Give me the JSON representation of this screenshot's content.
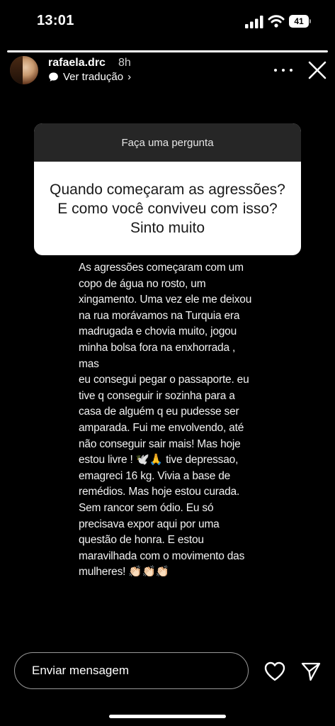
{
  "status_bar": {
    "time": "13:01",
    "battery_level": "41"
  },
  "story": {
    "progress": 1.0,
    "username": "rafaela.drc",
    "posted_ago": "8h",
    "translate_label": "Ver tradução",
    "translate_chevron": "›"
  },
  "question_sticker": {
    "header": "Faça uma pergunta",
    "question": "Quando começaram as agressões? E como você conviveu com isso? Sinto muito"
  },
  "answer": {
    "text": "As agressões começaram com um\ncopo de água no rosto, um\nxingamento. Uma vez ele me deixou\nna rua morávamos na Turquia era\nmadrugada e chovia muito, jogou\nminha bolsa fora na enxhorrada , mas\neu consegui pegar o passaporte. eu\ntive q conseguir ir sozinha para a\ncasa de alguém q eu pudesse ser\namparada. Fui me envolvendo, até\nnão conseguir sair mais! Mas hoje\nestou livre ! 🕊️🙏 tive depressao,\nemagreci 16 kg. Vivia a base de\nremédios. Mas hoje estou curada.\nSem rancor sem ódio. Eu só\nprecisava expor aqui por uma\nquestão de honra. E estou\nmaravilhada  com o movimento das\nmulheres! 👏🏻👏🏻👏🏻"
  },
  "footer": {
    "message_placeholder": "Enviar mensagem"
  },
  "icons": {
    "signal": "signal-icon",
    "wifi": "wifi-icon",
    "battery": "battery-icon",
    "translate": "speech-bubble-icon",
    "more": "more-options-icon",
    "close": "close-icon",
    "heart": "heart-icon",
    "send": "send-icon"
  }
}
